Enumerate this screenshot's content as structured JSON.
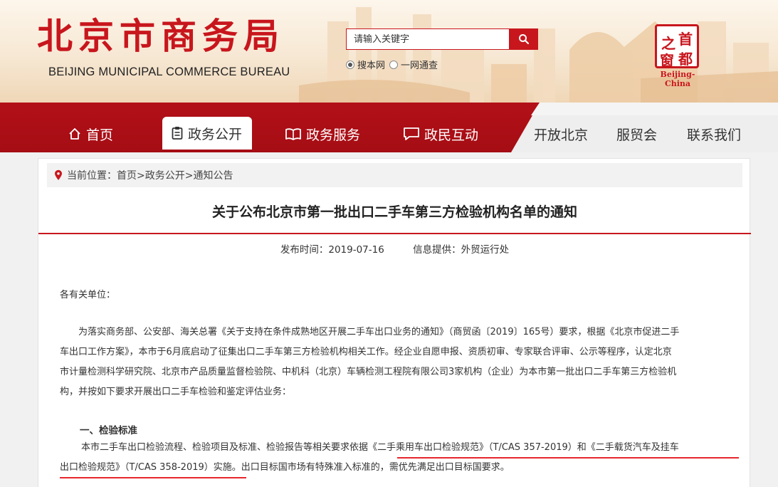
{
  "header": {
    "site_title": "北京市商务局",
    "site_subtitle": "BEIJING MUNICIPAL COMMERCE BUREAU",
    "search_placeholder": "请输入关键字",
    "search_options": [
      "搜本网",
      "一网通查"
    ],
    "search_selected": "搜本网",
    "badge_chars": [
      "首",
      "都",
      "之",
      "窗"
    ],
    "badge_caption": "Beijing-China"
  },
  "nav": {
    "items": [
      {
        "label": "首页",
        "icon": "home-icon"
      },
      {
        "label": "政务公开",
        "icon": "document-icon",
        "active": true
      },
      {
        "label": "政务服务",
        "icon": "book-icon"
      },
      {
        "label": "政民互动",
        "icon": "chat-icon"
      },
      {
        "label": "开放北京"
      },
      {
        "label": "服贸会"
      },
      {
        "label": "联系我们"
      }
    ]
  },
  "breadcrumb": {
    "text": "当前位置：首页>政务公开>通知公告"
  },
  "article": {
    "title": "关于公布北京市第一批出口二手车第三方检验机构名单的通知",
    "publish_time": "发布时间：2019-07-16",
    "source": "信息提供：外贸运行处",
    "salutation": "各有关单位：",
    "para1_lines": [
      "为落实商务部、公安部、海关总署《关于支持在条件成熟地区开展二手车出口业务的通知》（商贸函〔2019〕165号）要求，根据《北京市促进二手",
      "车出口工作方案》，本市于6月底启动了征集出口二手车第三方检验机构相关工作。经企业自愿申报、资质初审、专家联合评审、公示等程序，认定北京",
      "市计量检测科学研究院、北京市产品质量监督检验院、中机科（北京）车辆检测工程院有限公司3家机构（企业）为本市第一批出口二手车第三方检验机",
      "构，并按如下要求开展出口二手车检验和鉴定评估业务："
    ],
    "section1_heading": "一、检验标准",
    "para2_lines": [
      "本市二手车出口检验流程、检验项目及标准、检验报告等相关要求依据《二手乘用车出口检验规范》（T/CAS 357-2019）和《二手载货汽车及挂车",
      "出口检验规范》（T/CAS 358-2019）实施。出口目标国市场有特殊准入标准的，需优先满足出口目标国要求。"
    ]
  },
  "colors": {
    "brand_red": "#c8161d",
    "underline_red": "#e8262d"
  }
}
